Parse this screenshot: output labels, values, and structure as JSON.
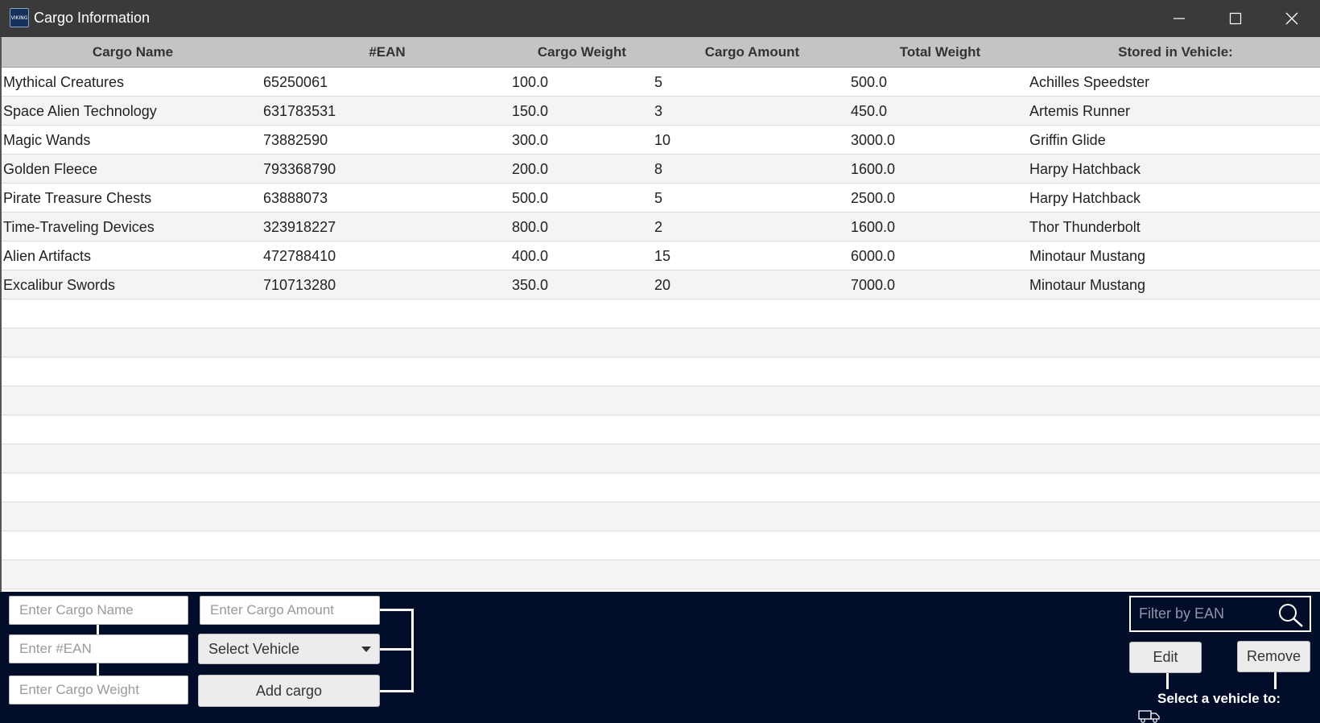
{
  "window": {
    "title": "Cargo Information",
    "logo_text": "VIKING"
  },
  "table": {
    "columns": [
      "Cargo Name",
      "#EAN",
      "Cargo Weight",
      "Cargo Amount",
      "Total Weight",
      "Stored in Vehicle:"
    ],
    "rows": [
      [
        "Mythical Creatures",
        "65250061",
        "100.0",
        "5",
        "500.0",
        "Achilles Speedster"
      ],
      [
        "Space Alien Technology",
        "631783531",
        "150.0",
        "3",
        "450.0",
        "Artemis Runner"
      ],
      [
        "Magic Wands",
        "73882590",
        "300.0",
        "10",
        "3000.0",
        "Griffin Glide"
      ],
      [
        "Golden Fleece",
        "793368790",
        "200.0",
        "8",
        "1600.0",
        "Harpy Hatchback"
      ],
      [
        "Pirate Treasure Chests",
        "63888073",
        "500.0",
        "5",
        "2500.0",
        "Harpy Hatchback"
      ],
      [
        "Time-Traveling Devices",
        "323918227",
        "800.0",
        "2",
        "1600.0",
        "Thor Thunderbolt"
      ],
      [
        "Alien Artifacts",
        "472788410",
        "400.0",
        "15",
        "6000.0",
        "Minotaur Mustang"
      ],
      [
        "Excalibur Swords",
        "710713280",
        "350.0",
        "20",
        "7000.0",
        "Minotaur Mustang"
      ]
    ]
  },
  "form": {
    "cargo_name_placeholder": "Enter Cargo Name",
    "ean_placeholder": "Enter #EAN",
    "cargo_weight_placeholder": "Enter Cargo Weight",
    "cargo_amount_placeholder": "Enter Cargo Amount",
    "vehicle_select": "Select Vehicle",
    "add_button": "Add cargo"
  },
  "actions": {
    "filter_placeholder": "Filter by EAN",
    "edit_button": "Edit",
    "remove_button": "Remove",
    "caption": "Select a vehicle to:"
  },
  "colors": {
    "titlebar": "#3a3a3a",
    "header": "#c4c4c4",
    "panel": "#020d2a"
  },
  "icons": {
    "app": "viking-logo-icon",
    "minimize": "minimize-icon",
    "maximize": "maximize-icon",
    "close": "close-icon",
    "search": "search-icon",
    "dropdown": "chevron-down-icon",
    "truck": "truck-icon"
  }
}
